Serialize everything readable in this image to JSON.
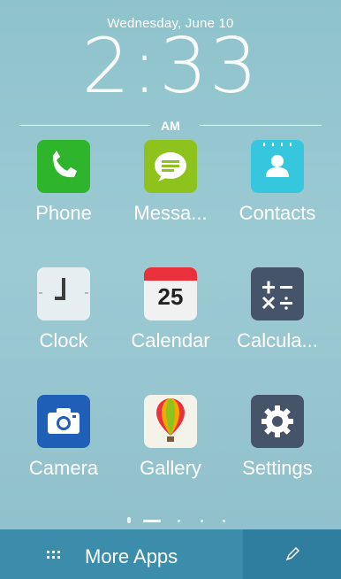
{
  "clock": {
    "date": "Wednesday, June 10",
    "time": "2:33",
    "ampm": "AM"
  },
  "apps": [
    {
      "label": "Phone",
      "icon": "phone-icon"
    },
    {
      "label": "Messa...",
      "icon": "messages-icon"
    },
    {
      "label": "Contacts",
      "icon": "contacts-icon"
    },
    {
      "label": "Clock",
      "icon": "clock-icon"
    },
    {
      "label": "Calendar",
      "icon": "calendar-icon",
      "day": "25"
    },
    {
      "label": "Calcula...",
      "icon": "calculator-icon"
    },
    {
      "label": "Camera",
      "icon": "camera-icon"
    },
    {
      "label": "Gallery",
      "icon": "gallery-icon"
    },
    {
      "label": "Settings",
      "icon": "settings-icon"
    }
  ],
  "bottom_bar": {
    "more_apps": "More Apps",
    "edit_icon": "pencil-icon"
  },
  "colors": {
    "phone": "#2fb52c",
    "messages": "#8ec21d",
    "contacts": "#36c6dd",
    "calculator": "#46546a",
    "camera": "#1f5fb8",
    "settings": "#46546a",
    "bottom_bar": "#3b8dab"
  }
}
